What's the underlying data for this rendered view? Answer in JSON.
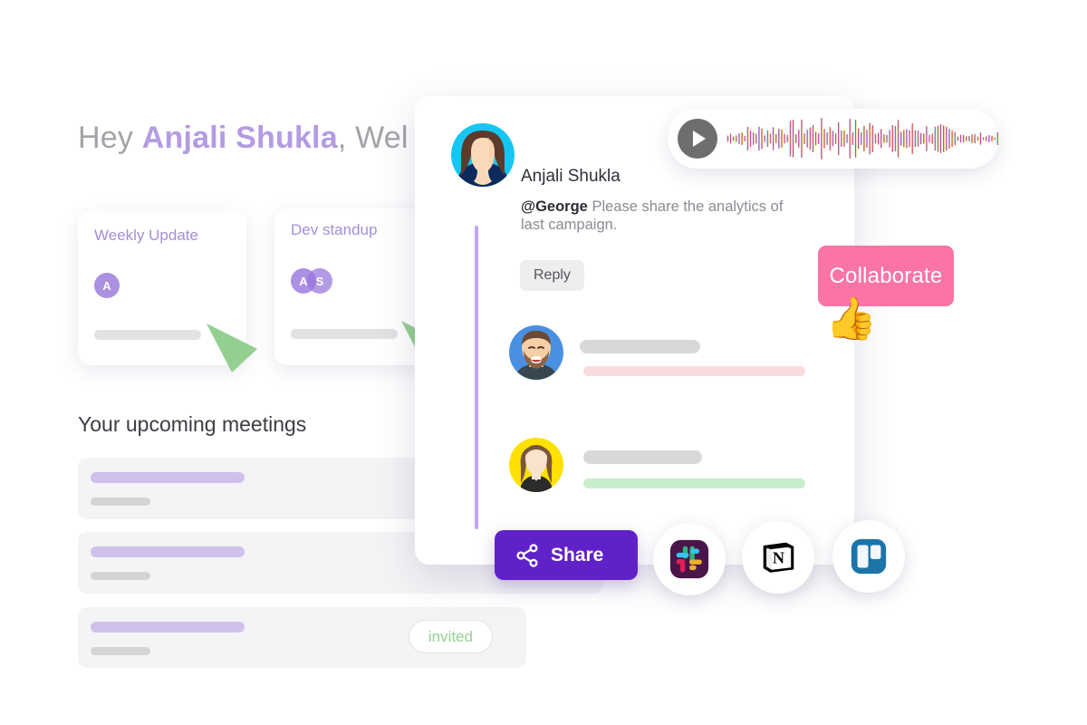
{
  "greeting": {
    "prefix": "Hey ",
    "name": "Anjali Shukla",
    "suffix": ", Wel"
  },
  "meeting_cards": [
    {
      "title": "Weekly Update",
      "avatars": [
        "A"
      ]
    },
    {
      "title": "Dev standup",
      "avatars": [
        "A",
        "S"
      ]
    }
  ],
  "upcoming": {
    "section_title": "Your upcoming meetings",
    "rows": [
      {
        "status": ""
      },
      {
        "status": ""
      },
      {
        "status": "invited"
      }
    ]
  },
  "comment_card": {
    "author": "Anjali Shukla",
    "mention": "@George",
    "message": " Please share the analytics of last campaign.",
    "reply_label": "Reply",
    "replies": [
      {
        "avatar": "man-avatar",
        "accent": "#f9dcdd"
      },
      {
        "avatar": "woman-avatar",
        "accent": "#c9eecb"
      }
    ]
  },
  "audio_player": {
    "play_icon": "play-icon",
    "waveform_icon": "audio-waveform"
  },
  "collaborate": {
    "label": "Collaborate",
    "emoji": "👍",
    "color": "#fa74a6"
  },
  "share": {
    "label": "Share",
    "icon": "share-icon",
    "color": "#6022c8"
  },
  "integrations": [
    {
      "name": "slack-icon"
    },
    {
      "name": "notion-icon"
    },
    {
      "name": "trello-icon"
    }
  ],
  "colors": {
    "purple_accent": "#b39ce3",
    "thread_line": "#c3a6f5",
    "green_marker": "#93d090",
    "invited_text": "#96d092"
  }
}
